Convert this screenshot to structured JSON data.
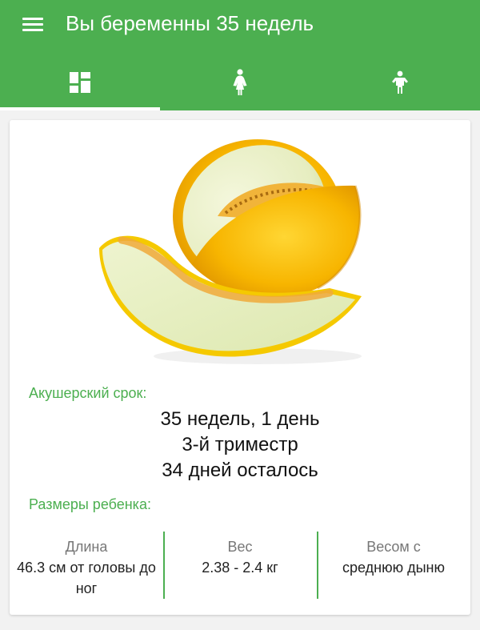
{
  "appbar": {
    "title": "Вы беременны 35 недель",
    "background": "#4caf50",
    "menu_icon": "hamburger-menu-icon"
  },
  "tabs": [
    {
      "icon": "dashboard-icon",
      "active": true
    },
    {
      "icon": "pregnant-woman-icon",
      "active": false
    },
    {
      "icon": "child-icon",
      "active": false
    }
  ],
  "card": {
    "image": "melon-illustration",
    "term_label": "Акушерский срок:",
    "term_weeks": "35 недель, 1 день",
    "trimester": "3-й триместр",
    "days_left": "34 дней осталось",
    "size_label": "Размеры ребенка:",
    "stats": [
      {
        "label": "Длина",
        "value": "46.3 см от головы до ног"
      },
      {
        "label": "Вес",
        "value": "2.38 - 2.4 кг"
      },
      {
        "label": "Весом с",
        "value": "среднюю дыню"
      }
    ]
  }
}
